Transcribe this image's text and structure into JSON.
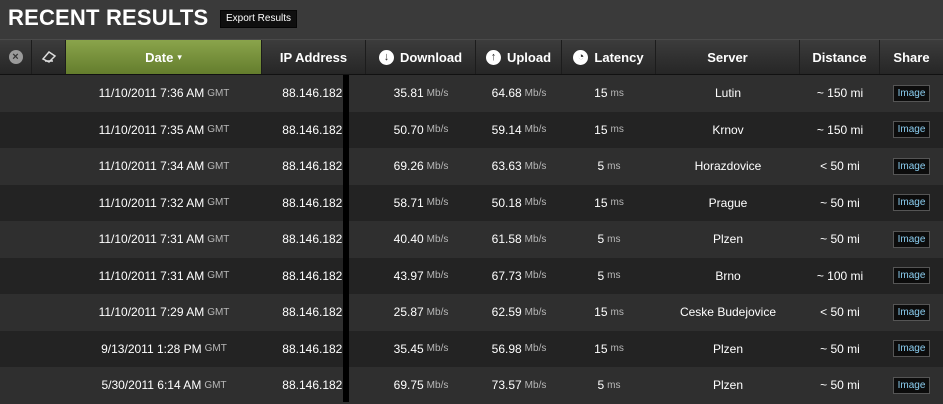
{
  "title": "RECENT RESULTS",
  "export_label": "Export Results",
  "columns": {
    "date": "Date",
    "ip": "IP Address",
    "download": "Download",
    "upload": "Upload",
    "latency": "Latency",
    "server": "Server",
    "distance": "Distance",
    "share": "Share"
  },
  "icons": {
    "close": "×",
    "delete": "⌫",
    "sort": "▾",
    "download": "↓",
    "upload": "↑",
    "latency": "◔"
  },
  "unit_speed": "Mb/s",
  "unit_latency": "ms",
  "share_label": "Image",
  "colors": {
    "active_header": "#7b9640",
    "share_text": "#8ccff2"
  },
  "rows": [
    {
      "date": "11/10/2011 7:36 AM",
      "tz": "GMT",
      "ip": "88.146.182.",
      "download": "35.81",
      "upload": "64.68",
      "latency": "15",
      "server": "Lutin",
      "distance": "~ 150 mi"
    },
    {
      "date": "11/10/2011 7:35 AM",
      "tz": "GMT",
      "ip": "88.146.182.",
      "download": "50.70",
      "upload": "59.14",
      "latency": "15",
      "server": "Krnov",
      "distance": "~ 150 mi"
    },
    {
      "date": "11/10/2011 7:34 AM",
      "tz": "GMT",
      "ip": "88.146.182.",
      "download": "69.26",
      "upload": "63.63",
      "latency": "5",
      "server": "Horazdovice",
      "distance": "< 50 mi"
    },
    {
      "date": "11/10/2011 7:32 AM",
      "tz": "GMT",
      "ip": "88.146.182.",
      "download": "58.71",
      "upload": "50.18",
      "latency": "15",
      "server": "Prague",
      "distance": "~ 50 mi"
    },
    {
      "date": "11/10/2011 7:31 AM",
      "tz": "GMT",
      "ip": "88.146.182.",
      "download": "40.40",
      "upload": "61.58",
      "latency": "5",
      "server": "Plzen",
      "distance": "~ 50 mi"
    },
    {
      "date": "11/10/2011 7:31 AM",
      "tz": "GMT",
      "ip": "88.146.182.",
      "download": "43.97",
      "upload": "67.73",
      "latency": "5",
      "server": "Brno",
      "distance": "~ 100 mi"
    },
    {
      "date": "11/10/2011 7:29 AM",
      "tz": "GMT",
      "ip": "88.146.182.",
      "download": "25.87",
      "upload": "62.59",
      "latency": "15",
      "server": "Ceske Budejovice",
      "distance": "< 50 mi"
    },
    {
      "date": "9/13/2011 1:28 PM",
      "tz": "GMT",
      "ip": "88.146.182.",
      "download": "35.45",
      "upload": "56.98",
      "latency": "15",
      "server": "Plzen",
      "distance": "~ 50 mi"
    },
    {
      "date": "5/30/2011 6:14 AM",
      "tz": "GMT",
      "ip": "88.146.182.",
      "download": "69.75",
      "upload": "73.57",
      "latency": "5",
      "server": "Plzen",
      "distance": "~ 50 mi"
    }
  ]
}
